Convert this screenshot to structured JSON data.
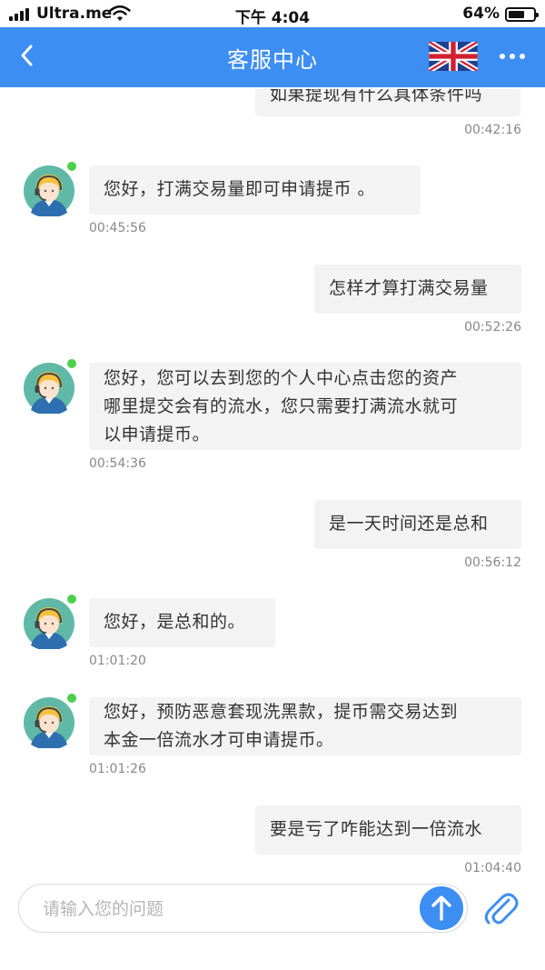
{
  "status_bar": {
    "carrier": "Ultra.me",
    "time": "下午 4:04",
    "battery": "64%",
    "battery_level": 0.64
  },
  "header": {
    "title": "客服中心",
    "back_icon": "chevron-left-icon",
    "flag_icon": "uk-flag-icon",
    "more_icon": "more-horizontal-icon"
  },
  "messages": [
    {
      "side": "right",
      "text": "如果提现有什么具体条件吗",
      "time": "00:42:16"
    },
    {
      "side": "left",
      "text": "您好，打满交易量即可申请提币 。",
      "time": "00:45:56"
    },
    {
      "side": "right",
      "text": "怎样才算打满交易量",
      "time": "00:52:26"
    },
    {
      "side": "left",
      "text": [
        "您好，您可以去到您的个人中心点击您的资产",
        "哪里提交会有的流水，您只需要打满流水就可",
        "以申请提币。"
      ],
      "time": "00:54:36"
    },
    {
      "side": "right",
      "text": "是一天时间还是总和",
      "time": "00:56:12"
    },
    {
      "side": "left",
      "text": "您好，是总和的。",
      "time": "01:01:20"
    },
    {
      "side": "left",
      "text": [
        "您好，预防恶意套现洗黑款，提币需交易达到",
        "本金一倍流水才可申请提币。"
      ],
      "time": "01:01:26"
    },
    {
      "side": "right",
      "text": "要是亏了咋能达到一倍流水",
      "time": "01:04:40"
    }
  ],
  "input": {
    "placeholder": "请输入您的问题",
    "value": ""
  },
  "colors": {
    "brand": "#3d8ef3",
    "bubble": "#f3f3f4",
    "online": "#4cd04a"
  }
}
